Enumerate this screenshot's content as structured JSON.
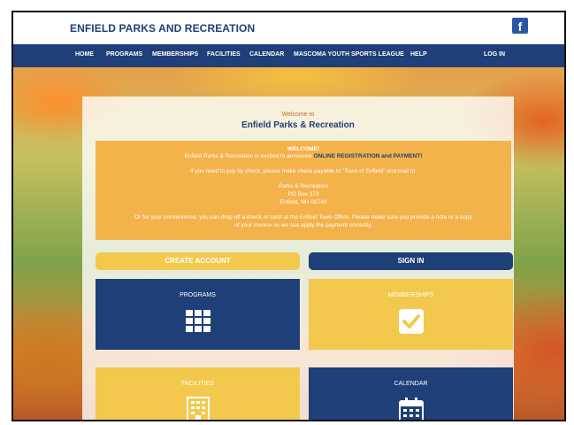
{
  "header": {
    "site_title": "ENFIELD PARKS AND RECREATION",
    "social_icon": "facebook-icon"
  },
  "nav": {
    "items": [
      "HOME",
      "PROGRAMS",
      "MEMBERSHIPS",
      "FACILITIES",
      "CALENDAR",
      "MASCOMA YOUTH SPORTS LEAGUE",
      "HELP"
    ],
    "login": "LOG IN"
  },
  "welcome": {
    "small": "Welcome to",
    "title": "Enfield Parks & Recreation"
  },
  "notice": {
    "heading": "WELCOME!",
    "line1_prefix": "Enfield Parks & Recreation is excited to announce",
    "line1_highlight": "ONLINE REGISTRATION and PAYMENT!",
    "line2": "If you need to pay by check, please make check payable to \"Town of Enfield\" and mail to:",
    "address1": "Parks & Recreation",
    "address2": "PO Box 373",
    "address3": "Enfield, NH 03748",
    "line3": "Or for your convenience, you can drop off a check or cash at the Enfield Town Office. Please make sure you provide a note or a copy",
    "line4": "of your invoice so we can apply the payment correctly."
  },
  "actions": {
    "create_account": "CREATE ACCOUNT",
    "sign_in": "SIGN IN"
  },
  "tiles": [
    {
      "label": "PROGRAMS",
      "icon": "grid-icon"
    },
    {
      "label": "MEMBERSHIPS",
      "icon": "checkbox-icon"
    },
    {
      "label": "FACILITIES",
      "icon": "building-icon"
    },
    {
      "label": "CALENDAR",
      "icon": "calendar-icon"
    }
  ],
  "colors": {
    "navy": "#1e3f78",
    "gold": "#f2c94c",
    "orange": "#f4b24a",
    "white": "#ffffff"
  }
}
